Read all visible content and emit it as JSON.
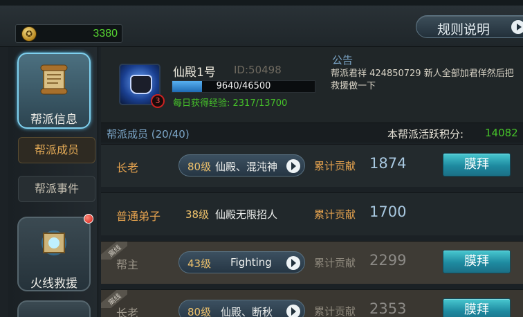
{
  "header": {
    "coin_value": "3380",
    "rules_button": "规则说明"
  },
  "sidebar": {
    "items": [
      {
        "label": "帮派信息",
        "active": true
      },
      {
        "label": "帮派成员",
        "selected": true
      },
      {
        "label": "帮派事件"
      },
      {
        "label": "火线救援",
        "has_notification": true
      }
    ]
  },
  "guild": {
    "name": "仙殿1号",
    "id": "ID:50498",
    "level": "3",
    "exp_text": "9640/46500",
    "exp_fraction": 0.207,
    "daily_exp": "每日获得经验: 2317/13700",
    "notice_title": "公告",
    "notice_text": "帮派君祥 424850729 新人全部加君佯然后把救援做一下"
  },
  "members": {
    "header_label": "帮派成员 (20/40)",
    "activity_label": "本帮派活跃积分:",
    "activity_value": "14082",
    "contribution_label": "累计贡献",
    "worship_label": "膜拜",
    "offline_tag": "离线",
    "rows": [
      {
        "role": "长老",
        "level": "80级",
        "name": "仙殿、混沌神",
        "contribution": "1874",
        "offline": false,
        "has_button": true
      },
      {
        "role": "普通弟子",
        "level": "38级",
        "name": "仙殿无限招人",
        "contribution": "1700",
        "offline": false,
        "has_button": false
      },
      {
        "role": "帮主",
        "level": "43级",
        "name": "Fighting",
        "contribution": "2299",
        "offline": true,
        "has_button": true
      },
      {
        "role": "长老",
        "level": "80级",
        "name": "仙殿、断秋",
        "contribution": "2353",
        "offline": true,
        "has_button": true
      }
    ]
  }
}
